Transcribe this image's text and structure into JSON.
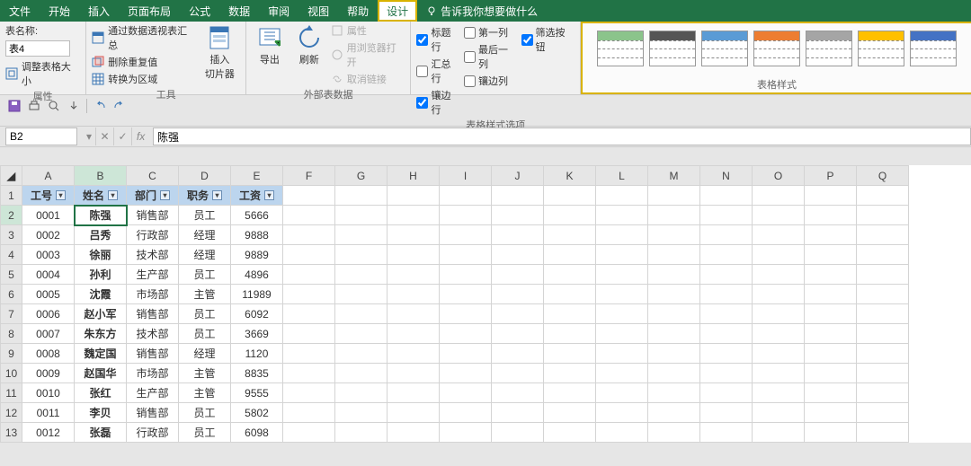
{
  "menu": {
    "items": [
      "文件",
      "开始",
      "插入",
      "页面布局",
      "公式",
      "数据",
      "审阅",
      "视图",
      "帮助",
      "设计"
    ],
    "active_index": 9,
    "tell_me": "告诉我你想要做什么"
  },
  "ribbon": {
    "props": {
      "name_label": "表名称:",
      "name_value": "表4",
      "resize": "调整表格大小",
      "group": "属性"
    },
    "tools": {
      "pivot": "通过数据透视表汇总",
      "dedup": "删除重复值",
      "range": "转换为区域",
      "slicer": "插入\n切片器",
      "group": "工具"
    },
    "ext": {
      "export": "导出",
      "refresh": "刷新",
      "prop": "属性",
      "browser": "用浏览器打开",
      "unlink": "取消链接",
      "group": "外部表数据"
    },
    "opts": {
      "header": "标题行",
      "total": "汇总行",
      "banded_row": "镶边行",
      "first_col": "第一列",
      "last_col": "最后一列",
      "banded_col": "镶边列",
      "filter": "筛选按钮",
      "group": "表格样式选项",
      "chk": {
        "header": true,
        "total": false,
        "banded_row": true,
        "first_col": false,
        "last_col": false,
        "banded_col": false,
        "filter": true
      }
    },
    "styles": {
      "group": "表格样式"
    }
  },
  "qat": {
    "icons": [
      "save",
      "print",
      "preview",
      "touch",
      "sep",
      "undo",
      "redo"
    ]
  },
  "formula_bar": {
    "name": "B2",
    "fx": "fx",
    "formula": "陈强"
  },
  "grid": {
    "cols": [
      "A",
      "B",
      "C",
      "D",
      "E",
      "F",
      "G",
      "H",
      "I",
      "J",
      "K",
      "L",
      "M",
      "N",
      "O",
      "P",
      "Q"
    ],
    "sel_col": 1,
    "sel_row": 1,
    "headers": [
      "工号",
      "姓名",
      "部门",
      "职务",
      "工资"
    ],
    "rows": [
      [
        "0001",
        "陈强",
        "销售部",
        "员工",
        "5666"
      ],
      [
        "0002",
        "吕秀",
        "行政部",
        "经理",
        "9888"
      ],
      [
        "0003",
        "徐丽",
        "技术部",
        "经理",
        "9889"
      ],
      [
        "0004",
        "孙利",
        "生产部",
        "员工",
        "4896"
      ],
      [
        "0005",
        "沈霞",
        "市场部",
        "主管",
        "11989"
      ],
      [
        "0006",
        "赵小军",
        "销售部",
        "员工",
        "6092"
      ],
      [
        "0007",
        "朱东方",
        "技术部",
        "员工",
        "3669"
      ],
      [
        "0008",
        "魏定国",
        "销售部",
        "经理",
        "1120"
      ],
      [
        "0009",
        "赵国华",
        "市场部",
        "主管",
        "8835"
      ],
      [
        "0010",
        "张红",
        "生产部",
        "主管",
        "9555"
      ],
      [
        "0011",
        "李贝",
        "销售部",
        "员工",
        "5802"
      ],
      [
        "0012",
        "张磊",
        "行政部",
        "员工",
        "6098"
      ]
    ]
  },
  "chart_data": {
    "type": "table",
    "headers": [
      "工号",
      "姓名",
      "部门",
      "职务",
      "工资"
    ],
    "rows": [
      [
        "0001",
        "陈强",
        "销售部",
        "员工",
        5666
      ],
      [
        "0002",
        "吕秀",
        "行政部",
        "经理",
        9888
      ],
      [
        "0003",
        "徐丽",
        "技术部",
        "经理",
        9889
      ],
      [
        "0004",
        "孙利",
        "生产部",
        "员工",
        4896
      ],
      [
        "0005",
        "沈霞",
        "市场部",
        "主管",
        11989
      ],
      [
        "0006",
        "赵小军",
        "销售部",
        "员工",
        6092
      ],
      [
        "0007",
        "朱东方",
        "技术部",
        "员工",
        3669
      ],
      [
        "0008",
        "魏定国",
        "销售部",
        "经理",
        1120
      ],
      [
        "0009",
        "赵国华",
        "市场部",
        "主管",
        8835
      ],
      [
        "0010",
        "张红",
        "生产部",
        "主管",
        9555
      ],
      [
        "0011",
        "李贝",
        "销售部",
        "员工",
        5802
      ],
      [
        "0012",
        "张磊",
        "行政部",
        "员工",
        6098
      ]
    ]
  }
}
